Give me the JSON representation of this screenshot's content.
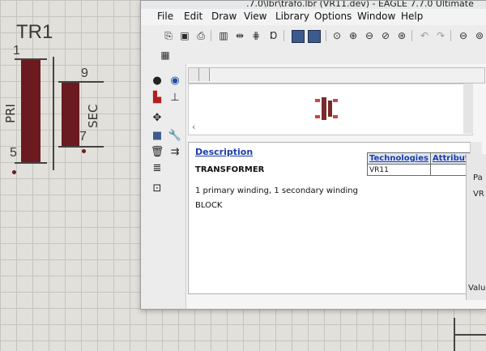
{
  "schematic": {
    "part_name": "TR1",
    "pin_1": "1",
    "pin_5": "5",
    "pin_9": "9",
    "pin_7": "7",
    "primary_label": "PRI",
    "secondary_label": "SEC",
    "coil_color": "#6b1a1f"
  },
  "window": {
    "title": ".7.0\\lbr\\trafo.lbr (VR11.dev) - EAGLE 7.7.0 Ultimate",
    "menu": [
      "File",
      "Edit",
      "Draw",
      "View",
      "Library",
      "Options",
      "Window",
      "Help"
    ]
  },
  "toolbar": {
    "icons": [
      "open-icon",
      "save-icon",
      "print-icon",
      "book-icon",
      "symbol-icon",
      "package-icon",
      "device-icon",
      "zoom-in-icon",
      "zoom-out-icon",
      "undo-icon",
      "redo-icon",
      "stop-icon"
    ]
  },
  "device": {
    "description_link": "Description",
    "heading": "TRANSFORMER",
    "line1": "1 primary winding, 1 secondary winding",
    "line2": "BLOCK",
    "table_headers": [
      "Technologies",
      "Attributes"
    ],
    "table_rows": [
      [
        "VR11",
        ""
      ]
    ]
  },
  "side_panel": {
    "item1": "Pa",
    "item2": "VR",
    "value_label": "Value"
  },
  "colors": {
    "link": "#1b3ea8",
    "window_bg": "#f0f0f0"
  }
}
